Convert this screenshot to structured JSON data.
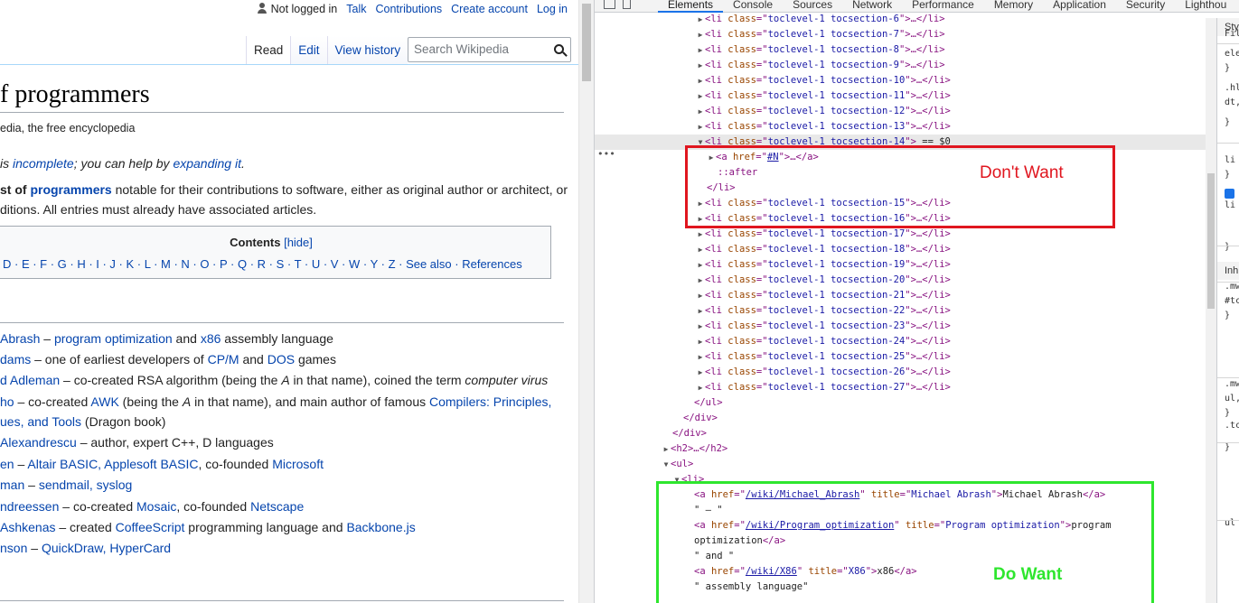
{
  "wiki": {
    "personal": {
      "not_logged_in": "Not logged in",
      "talk": "Talk",
      "contributions": "Contributions",
      "create_account": "Create account",
      "log_in": "Log in"
    },
    "tabs": {
      "read": "Read",
      "edit": "Edit",
      "view_history": "View history"
    },
    "search_placeholder": "Search Wikipedia",
    "title": "f programmers",
    "tagline": "edia, the free encyclopedia",
    "incomplete": {
      "a": "is ",
      "b": "incomplete",
      "c": "; you can help by ",
      "d": "expanding it",
      "e": "."
    },
    "intro1": {
      "a": "st of ",
      "b": "programmers",
      "c": " notable for their contributions to software, either as original author or architect, or"
    },
    "intro2": "ditions. All entries must already have associated articles.",
    "toc": {
      "title": "Contents",
      "hide": "[hide]",
      "letters": "D · E · F · G · H · I · J · K · L · M · N · O · P · Q · R · S · T · U · V · W · Y · Z · See also · References"
    },
    "entries": [
      [
        [
          "l",
          " Abrash"
        ],
        [
          "t",
          " – "
        ],
        [
          "l",
          "program optimization"
        ],
        [
          "t",
          " and "
        ],
        [
          "l",
          "x86"
        ],
        [
          "t",
          " assembly language"
        ]
      ],
      [
        [
          "l",
          "dams"
        ],
        [
          "t",
          " – one of earliest developers of "
        ],
        [
          "l",
          "CP/M"
        ],
        [
          "t",
          " and "
        ],
        [
          "l",
          "DOS"
        ],
        [
          "t",
          " games"
        ]
      ],
      [
        [
          "l",
          "d Adleman"
        ],
        [
          "t",
          " – co-created RSA algorithm (being the "
        ],
        [
          "i",
          "A"
        ],
        [
          "t",
          " in that name), coined the term "
        ],
        [
          "i",
          "computer virus"
        ]
      ],
      [
        [
          "l",
          "ho"
        ],
        [
          "t",
          " – co-created "
        ],
        [
          "l",
          "AWK"
        ],
        [
          "t",
          " (being the "
        ],
        [
          "i",
          "A"
        ],
        [
          "t",
          " in that name), and main author of famous "
        ],
        [
          "l",
          "Compilers: Principles,"
        ]
      ],
      [
        [
          "l",
          "ues, and Tools"
        ],
        [
          "t",
          " (Dragon book)"
        ]
      ],
      [
        [
          "l",
          "Alexandrescu"
        ],
        [
          "t",
          " – author, expert C++, D languages"
        ]
      ],
      [
        [
          "l",
          "en"
        ],
        [
          "t",
          " – "
        ],
        [
          "l",
          "Altair BASIC, Applesoft BASIC"
        ],
        [
          "t",
          ", co-founded "
        ],
        [
          "l",
          "Microsoft"
        ]
      ],
      [
        [
          "l",
          "man"
        ],
        [
          "t",
          " – "
        ],
        [
          "l",
          "sendmail, syslog"
        ]
      ],
      [
        [
          "l",
          "ndreessen"
        ],
        [
          "t",
          " – co-created "
        ],
        [
          "l",
          "Mosaic"
        ],
        [
          "t",
          ", co-founded "
        ],
        [
          "l",
          "Netscape"
        ]
      ],
      [
        [
          "l",
          " Ashkenas"
        ],
        [
          "t",
          " – created "
        ],
        [
          "l",
          "CoffeeScript"
        ],
        [
          "t",
          " programming language and "
        ],
        [
          "l",
          "Backbone.js"
        ]
      ],
      [
        [
          "l",
          "nson"
        ],
        [
          "t",
          " – "
        ],
        [
          "l",
          "QuickDraw, HyperCard"
        ]
      ]
    ]
  },
  "devtools": {
    "tabs": [
      "Elements",
      "Console",
      "Sources",
      "Network",
      "Performance",
      "Memory",
      "Application",
      "Security",
      "Lighthou"
    ],
    "toc_items": [
      "toclevel-1 tocsection-6",
      "toclevel-1 tocsection-7",
      "toclevel-1 tocsection-8",
      "toclevel-1 tocsection-9",
      "toclevel-1 tocsection-10",
      "toclevel-1 tocsection-11",
      "toclevel-1 tocsection-12",
      "toclevel-1 tocsection-13"
    ],
    "selected_li": "toclevel-1 tocsection-14",
    "selected_suffix": "== $0",
    "anchor_href": "#N",
    "pseudo_after": "::after",
    "toc_items_after": [
      "toclevel-1 tocsection-15",
      "toclevel-1 tocsection-16",
      "toclevel-1 tocsection-17",
      "toclevel-1 tocsection-18",
      "toclevel-1 tocsection-19",
      "toclevel-1 tocsection-20",
      "toclevel-1 tocsection-21",
      "toclevel-1 tocsection-22",
      "toclevel-1 tocsection-23",
      "toclevel-1 tocsection-24",
      "toclevel-1 tocsection-25",
      "toclevel-1 tocsection-26",
      "toclevel-1 tocsection-27"
    ],
    "close_ul": "</ul>",
    "close_div": "</div>",
    "h2": "<h2>…</h2>",
    "open_ul": "<ul>",
    "open_li": "<li>",
    "green_block": {
      "a1_href": "/wiki/Michael_Abrash",
      "a1_title": "Michael Abrash",
      "a1_text": "Michael Abrash",
      "dash": "\" – \"",
      "a2_href": "/wiki/Program_optimization",
      "a2_title": "Program optimization",
      "a2_text1": "program",
      "a2_text2": "optimization",
      "and": "\" and \"",
      "a3_href": "/wiki/X86",
      "a3_title": "X86",
      "a3_text": "x86",
      "assembly": "\" assembly language\""
    },
    "annotations": {
      "dont_want": "Don't Want",
      "do_want": "Do Want"
    },
    "styles_snippets": [
      "Sty",
      "Filt",
      "ele",
      "}",
      ".hl",
      "dt,",
      "}",
      "li",
      "}",
      "li",
      "}",
      "Inh",
      ".mw",
      "#tc",
      "}",
      ".mw",
      "ul,",
      "}",
      ".tc",
      "}",
      "ul"
    ]
  },
  "colors": {
    "link": "#0645ad",
    "red_box": "#e0161f",
    "green_box": "#2ee62e",
    "devtools_tag": "#881280",
    "devtools_attr": "#994500",
    "devtools_value": "#1a1aa6"
  }
}
